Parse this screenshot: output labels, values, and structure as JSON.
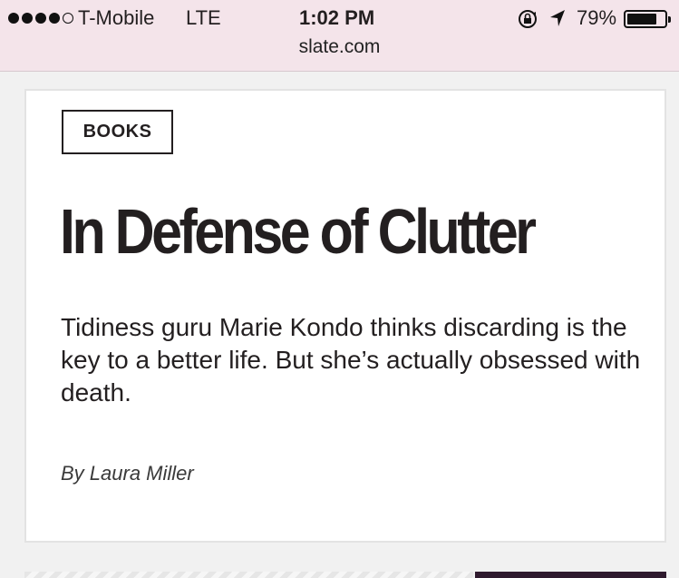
{
  "status_bar": {
    "carrier": "T-Mobile",
    "network": "LTE",
    "time": "1:02 PM",
    "battery_percent": "79%",
    "battery_level": 0.79,
    "signal_bars_filled": 4,
    "signal_bars_total": 5
  },
  "browser": {
    "url": "slate.com"
  },
  "article": {
    "section": "BOOKS",
    "headline": "In Defense of Clutter",
    "dek": "Tidiness guru Marie Kondo thinks discarding is the key to a better life. But she’s actually obsessed with death.",
    "byline": "By Laura Miller"
  },
  "colors": {
    "browser_chrome": "#f4e4ea",
    "text": "#231f20",
    "accent_bar": "#2f1a2e"
  }
}
